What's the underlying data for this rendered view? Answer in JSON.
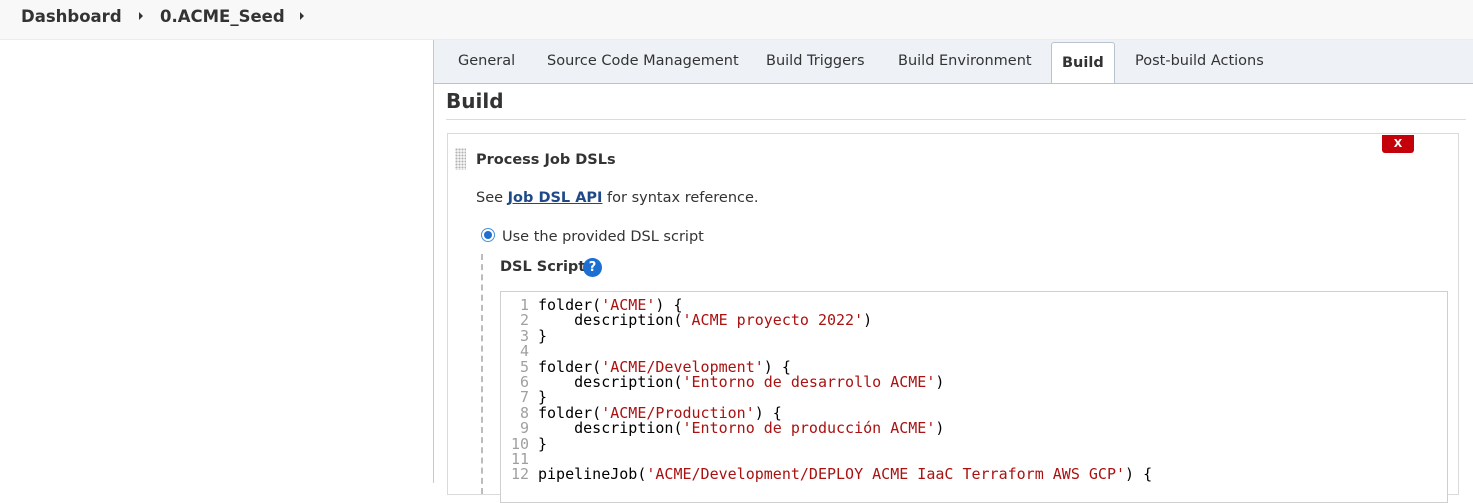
{
  "breadcrumb": {
    "items": [
      "Dashboard",
      "0.ACME_Seed"
    ]
  },
  "tabs": [
    {
      "label": "General"
    },
    {
      "label": "Source Code Management"
    },
    {
      "label": "Build Triggers"
    },
    {
      "label": "Build Environment"
    },
    {
      "label": "Build",
      "active": true
    },
    {
      "label": "Post-build Actions"
    }
  ],
  "section": {
    "title": "Build"
  },
  "builder": {
    "title": "Process Job DSLs",
    "delete_label": "X",
    "help_prefix": "See ",
    "help_link": "Job DSL API",
    "help_suffix": " for syntax reference.",
    "radio_label": "Use the provided DSL script",
    "radio_checked": true,
    "script_label": "DSL Script",
    "help_icon": "?"
  },
  "editor": {
    "lines": [
      {
        "n": "1",
        "code": [
          [
            "folder(",
            0
          ],
          [
            "'ACME'",
            1
          ],
          [
            ") {",
            0
          ]
        ]
      },
      {
        "n": "2",
        "code": [
          [
            "    description(",
            0
          ],
          [
            "'ACME proyecto 2022'",
            1
          ],
          [
            ")",
            0
          ]
        ]
      },
      {
        "n": "3",
        "code": [
          [
            "}",
            0
          ]
        ]
      },
      {
        "n": "4",
        "code": []
      },
      {
        "n": "5",
        "code": [
          [
            "folder(",
            0
          ],
          [
            "'ACME/Development'",
            1
          ],
          [
            ") {",
            0
          ]
        ]
      },
      {
        "n": "6",
        "code": [
          [
            "    description(",
            0
          ],
          [
            "'Entorno de desarrollo ACME'",
            1
          ],
          [
            ")",
            0
          ]
        ]
      },
      {
        "n": "7",
        "code": [
          [
            "}",
            0
          ]
        ]
      },
      {
        "n": "8",
        "code": [
          [
            "folder(",
            0
          ],
          [
            "'ACME/Production'",
            1
          ],
          [
            ") {",
            0
          ]
        ]
      },
      {
        "n": "9",
        "code": [
          [
            "    description(",
            0
          ],
          [
            "'Entorno de producción ACME'",
            1
          ],
          [
            ")",
            0
          ]
        ]
      },
      {
        "n": "10",
        "code": [
          [
            "}",
            0
          ]
        ]
      },
      {
        "n": "11",
        "code": []
      },
      {
        "n": "12",
        "code": [
          [
            "pipelineJob(",
            0
          ],
          [
            "'ACME/Development/DEPLOY ACME IaaC Terraform AWS GCP'",
            1
          ],
          [
            ") {",
            0
          ]
        ]
      }
    ]
  },
  "colors": {
    "accent": "#1f6fd0",
    "danger": "#c4000a",
    "string": "#aa1111",
    "link": "#204a87"
  }
}
